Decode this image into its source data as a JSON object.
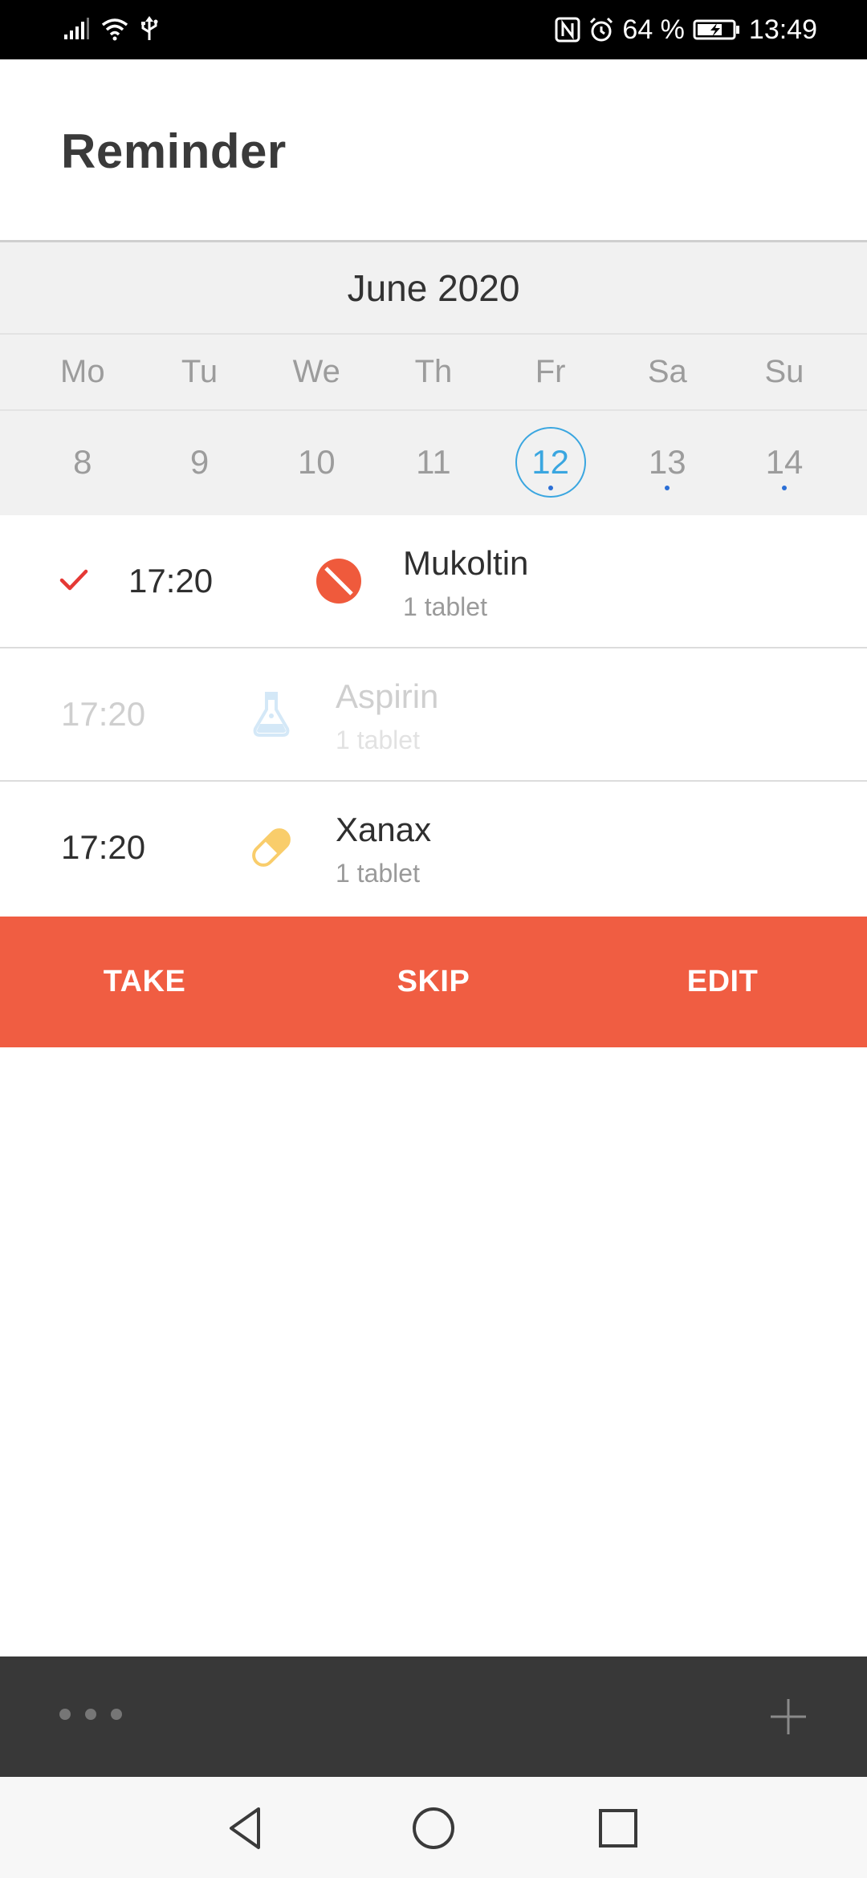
{
  "status_bar": {
    "battery_percent": "64 %",
    "time": "13:49",
    "icons": [
      "signal-icon",
      "wifi-icon",
      "usb-icon",
      "nfc-icon",
      "alarm-icon",
      "battery-icon"
    ]
  },
  "header": {
    "title": "Reminder"
  },
  "calendar": {
    "month_label": "June 2020",
    "weekdays": [
      "Mo",
      "Tu",
      "We",
      "Th",
      "Fr",
      "Sa",
      "Su"
    ],
    "dates": [
      {
        "day": "8",
        "selected": false,
        "has_reminder": false
      },
      {
        "day": "9",
        "selected": false,
        "has_reminder": false
      },
      {
        "day": "10",
        "selected": false,
        "has_reminder": false
      },
      {
        "day": "11",
        "selected": false,
        "has_reminder": false
      },
      {
        "day": "12",
        "selected": true,
        "has_reminder": true
      },
      {
        "day": "13",
        "selected": false,
        "has_reminder": true
      },
      {
        "day": "14",
        "selected": false,
        "has_reminder": true
      }
    ],
    "accent_color": "#3aa6e0"
  },
  "reminders": [
    {
      "time": "17:20",
      "name": "Mukoltin",
      "dose": "1 tablet",
      "icon": "pill-round-icon",
      "status": "taken"
    },
    {
      "time": "17:20",
      "name": "Aspirin",
      "dose": "1 tablet",
      "icon": "flask-icon",
      "status": "skipped"
    },
    {
      "time": "17:20",
      "name": "Xanax",
      "dose": "1 tablet",
      "icon": "capsule-icon",
      "status": "pending"
    }
  ],
  "actions": {
    "take_label": "TAKE",
    "skip_label": "SKIP",
    "edit_label": "EDIT",
    "bar_color": "#f05d42"
  },
  "toolbar": {
    "more_icon": "more-dots-icon",
    "add_icon": "plus-icon"
  },
  "system_nav": {
    "icons": [
      "back-icon",
      "home-icon",
      "recents-icon"
    ]
  }
}
